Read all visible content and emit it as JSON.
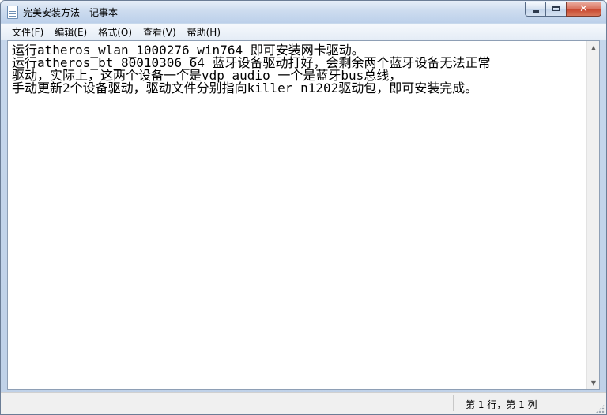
{
  "window": {
    "title": "完美安装方法 - 记事本"
  },
  "menu": {
    "items": [
      "文件(F)",
      "编辑(E)",
      "格式(O)",
      "查看(V)",
      "帮助(H)"
    ]
  },
  "document": {
    "lines": [
      "运行atheros_wlan_1000276_win764 即可安装网卡驱动。",
      "运行atheros_bt_80010306_64 蓝牙设备驱动打好，会剩余两个蓝牙设备无法正常",
      "驱动，实际上，这两个设备一个是vdp audio 一个是蓝牙bus总线，",
      "手动更新2个设备驱动，驱动文件分别指向killer n1202驱动包，即可安装完成。"
    ]
  },
  "status": {
    "position": "第 1 行，第 1 列"
  },
  "icons": {
    "app": "notepad-icon",
    "minimize": "minimize-icon",
    "maximize": "maximize-icon",
    "close": "close-icon",
    "scroll_up": "arrow-up-icon",
    "scroll_down": "arrow-down-icon",
    "grip": "resize-grip-icon"
  }
}
